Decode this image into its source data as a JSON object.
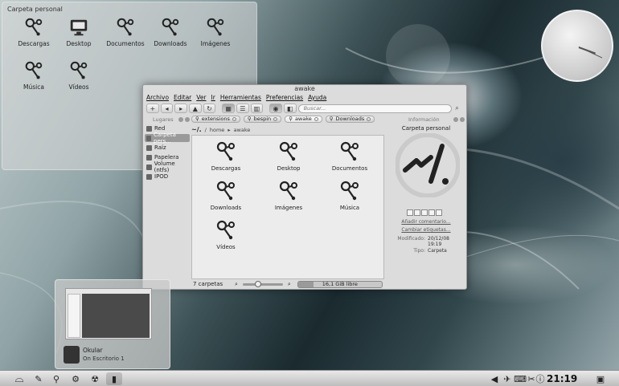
{
  "folderview": {
    "title": "Carpeta personal",
    "items": [
      "Descargas",
      "Desktop",
      "Documentos",
      "Downloads",
      "Imágenes",
      "Música",
      "Vídeos"
    ]
  },
  "window": {
    "title": "awake",
    "menu": [
      "Archivo",
      "Editar",
      "Ver",
      "Ir",
      "Herramientas",
      "Preferencias",
      "Ayuda"
    ],
    "search_placeholder": "Buscar...",
    "places": {
      "header": "Lugares",
      "items": [
        "Red",
        "Carpeta pers...",
        "Raíz",
        "Papelera",
        "Volume (ntfs)",
        "IPOD"
      ]
    },
    "tabs": [
      "extensions",
      "bespin",
      "awake",
      "Downloads"
    ],
    "breadcrumb": {
      "home_glyph": "~/.",
      "separator": "/",
      "parts": [
        "home",
        "awake"
      ]
    },
    "files": [
      "Descargas",
      "Desktop",
      "Documentos",
      "Downloads",
      "Imágenes",
      "Música",
      "Vídeos"
    ],
    "status": {
      "count": "7 carpetas",
      "free": "16,1 GiB libre",
      "used_fraction": 0.18,
      "zoom_fraction": 0.35
    },
    "info": {
      "header": "Información",
      "name": "Carpeta personal",
      "preview_glyph": "~/.",
      "add_comment": "Añadir comentario...",
      "change_tags": "Cambiar etiquetas...",
      "modified_label": "Modificado:",
      "modified_value": "20/12/08 19:19",
      "type_label": "Tipo:",
      "type_value": "Carpeta"
    }
  },
  "task_preview": {
    "name": "Okular",
    "desktop": "On Escritorio 1"
  },
  "panel": {
    "time": "21:19"
  },
  "icons": {
    "folder": "link-folder-icon",
    "desktop": "monitor-icon",
    "launcher": "kde-launcher-icon"
  }
}
